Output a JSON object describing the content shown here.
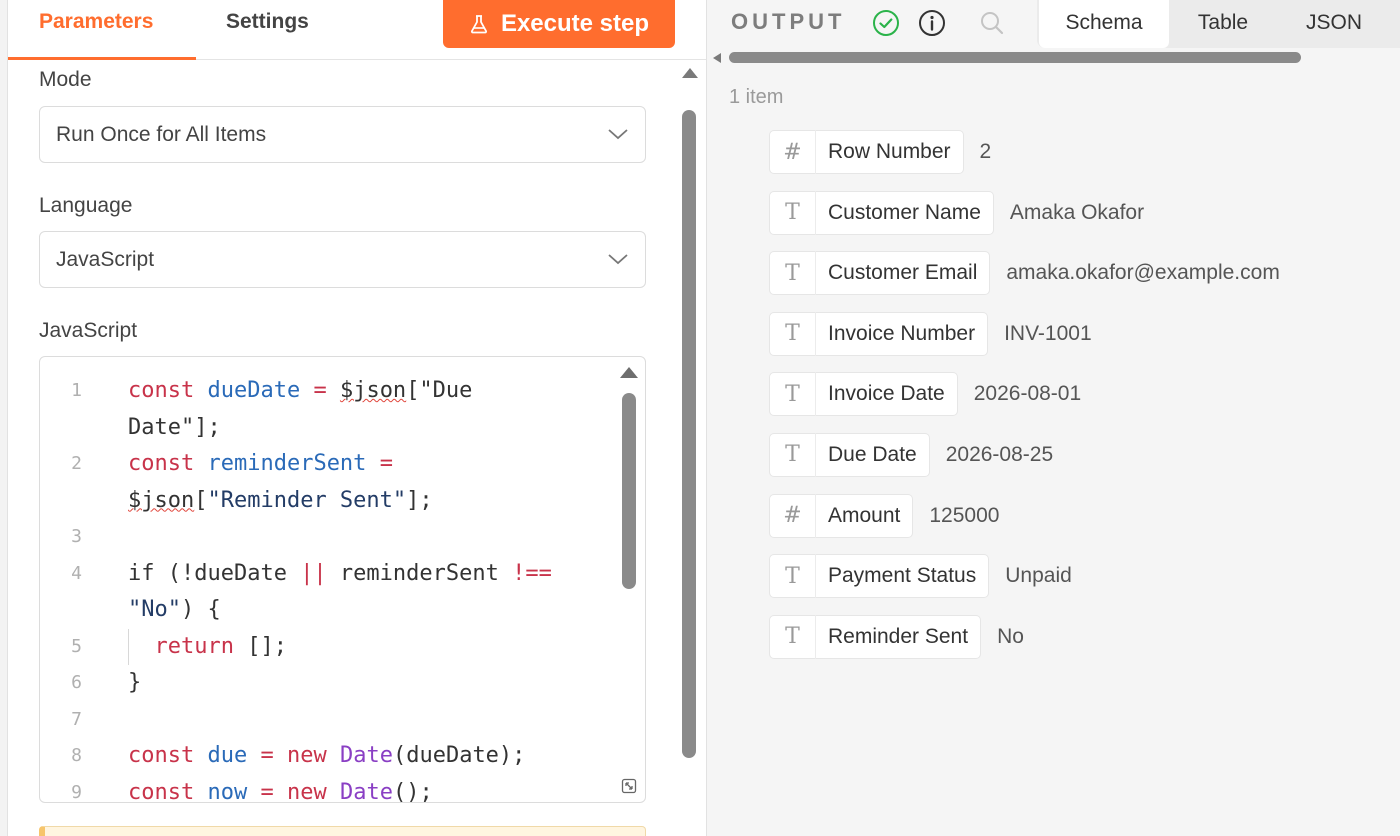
{
  "params_panel": {
    "tabs": [
      {
        "label": "Parameters"
      },
      {
        "label": "Settings"
      }
    ],
    "execute_label": "Execute step",
    "mode": {
      "label": "Mode",
      "value": "Run Once for All Items"
    },
    "language": {
      "label": "Language",
      "value": "JavaScript"
    },
    "code_label": "JavaScript",
    "code_lines": [
      {
        "n": "1",
        "text": "const dueDate = $json[\"Due"
      },
      {
        "n": "",
        "text": "Date\"];"
      },
      {
        "n": "2",
        "text": "const reminderSent ="
      },
      {
        "n": "",
        "text": "$json[\"Reminder Sent\"];"
      },
      {
        "n": "3",
        "text": ""
      },
      {
        "n": "4",
        "text": "if (!dueDate || reminderSent !=="
      },
      {
        "n": "",
        "text": "\"No\") {"
      },
      {
        "n": "5",
        "text": "  return [];"
      },
      {
        "n": "6",
        "text": "}"
      },
      {
        "n": "7",
        "text": ""
      },
      {
        "n": "8",
        "text": "const due = new Date(dueDate);"
      },
      {
        "n": "9",
        "text": "const now = new Date();"
      }
    ]
  },
  "output_panel": {
    "title": "OUTPUT",
    "view_tabs": [
      {
        "label": "Schema"
      },
      {
        "label": "Table"
      },
      {
        "label": "JSON"
      }
    ],
    "item_count": "1 item",
    "fields": [
      {
        "type": "#",
        "name": "Row Number",
        "value": "2"
      },
      {
        "type": "T",
        "name": "Customer Name",
        "value": "Amaka Okafor"
      },
      {
        "type": "T",
        "name": "Customer Email",
        "value": "amaka.okafor@example.com"
      },
      {
        "type": "T",
        "name": "Invoice Number",
        "value": "INV-1001"
      },
      {
        "type": "T",
        "name": "Invoice Date",
        "value": "2026-08-01"
      },
      {
        "type": "T",
        "name": "Due Date",
        "value": "2026-08-25"
      },
      {
        "type": "#",
        "name": "Amount",
        "value": "125000"
      },
      {
        "type": "T",
        "name": "Payment Status",
        "value": "Unpaid"
      },
      {
        "type": "T",
        "name": "Reminder Sent",
        "value": "No"
      }
    ]
  },
  "colors": {
    "accent": "#ff6d2e",
    "success": "#2bb34a"
  },
  "icons": [
    "flask-icon",
    "chevron-down-icon",
    "check-circle-icon",
    "info-icon",
    "search-icon",
    "expand-icon"
  ]
}
